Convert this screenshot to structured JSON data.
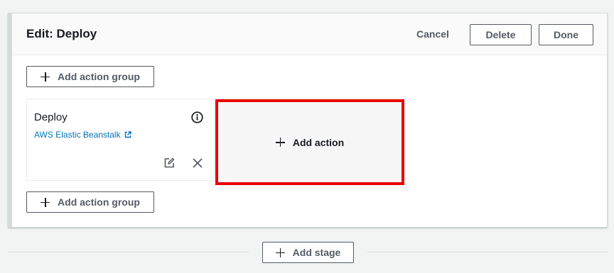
{
  "stage": {
    "title": "Edit: Deploy",
    "cancel_label": "Cancel",
    "delete_label": "Delete",
    "done_label": "Done",
    "add_action_group_label": "Add action group",
    "action": {
      "name": "Deploy",
      "provider": "AWS Elastic Beanstalk",
      "info_icon": "info-icon",
      "external_icon": "external-link-icon",
      "edit_icon": "edit-icon",
      "remove_icon": "close-icon"
    },
    "add_action_label": "Add action"
  },
  "pipeline": {
    "add_stage_label": "Add stage"
  },
  "colors": {
    "highlight": "#ea0000",
    "link": "#0073bb",
    "button_border": "#545b64"
  }
}
